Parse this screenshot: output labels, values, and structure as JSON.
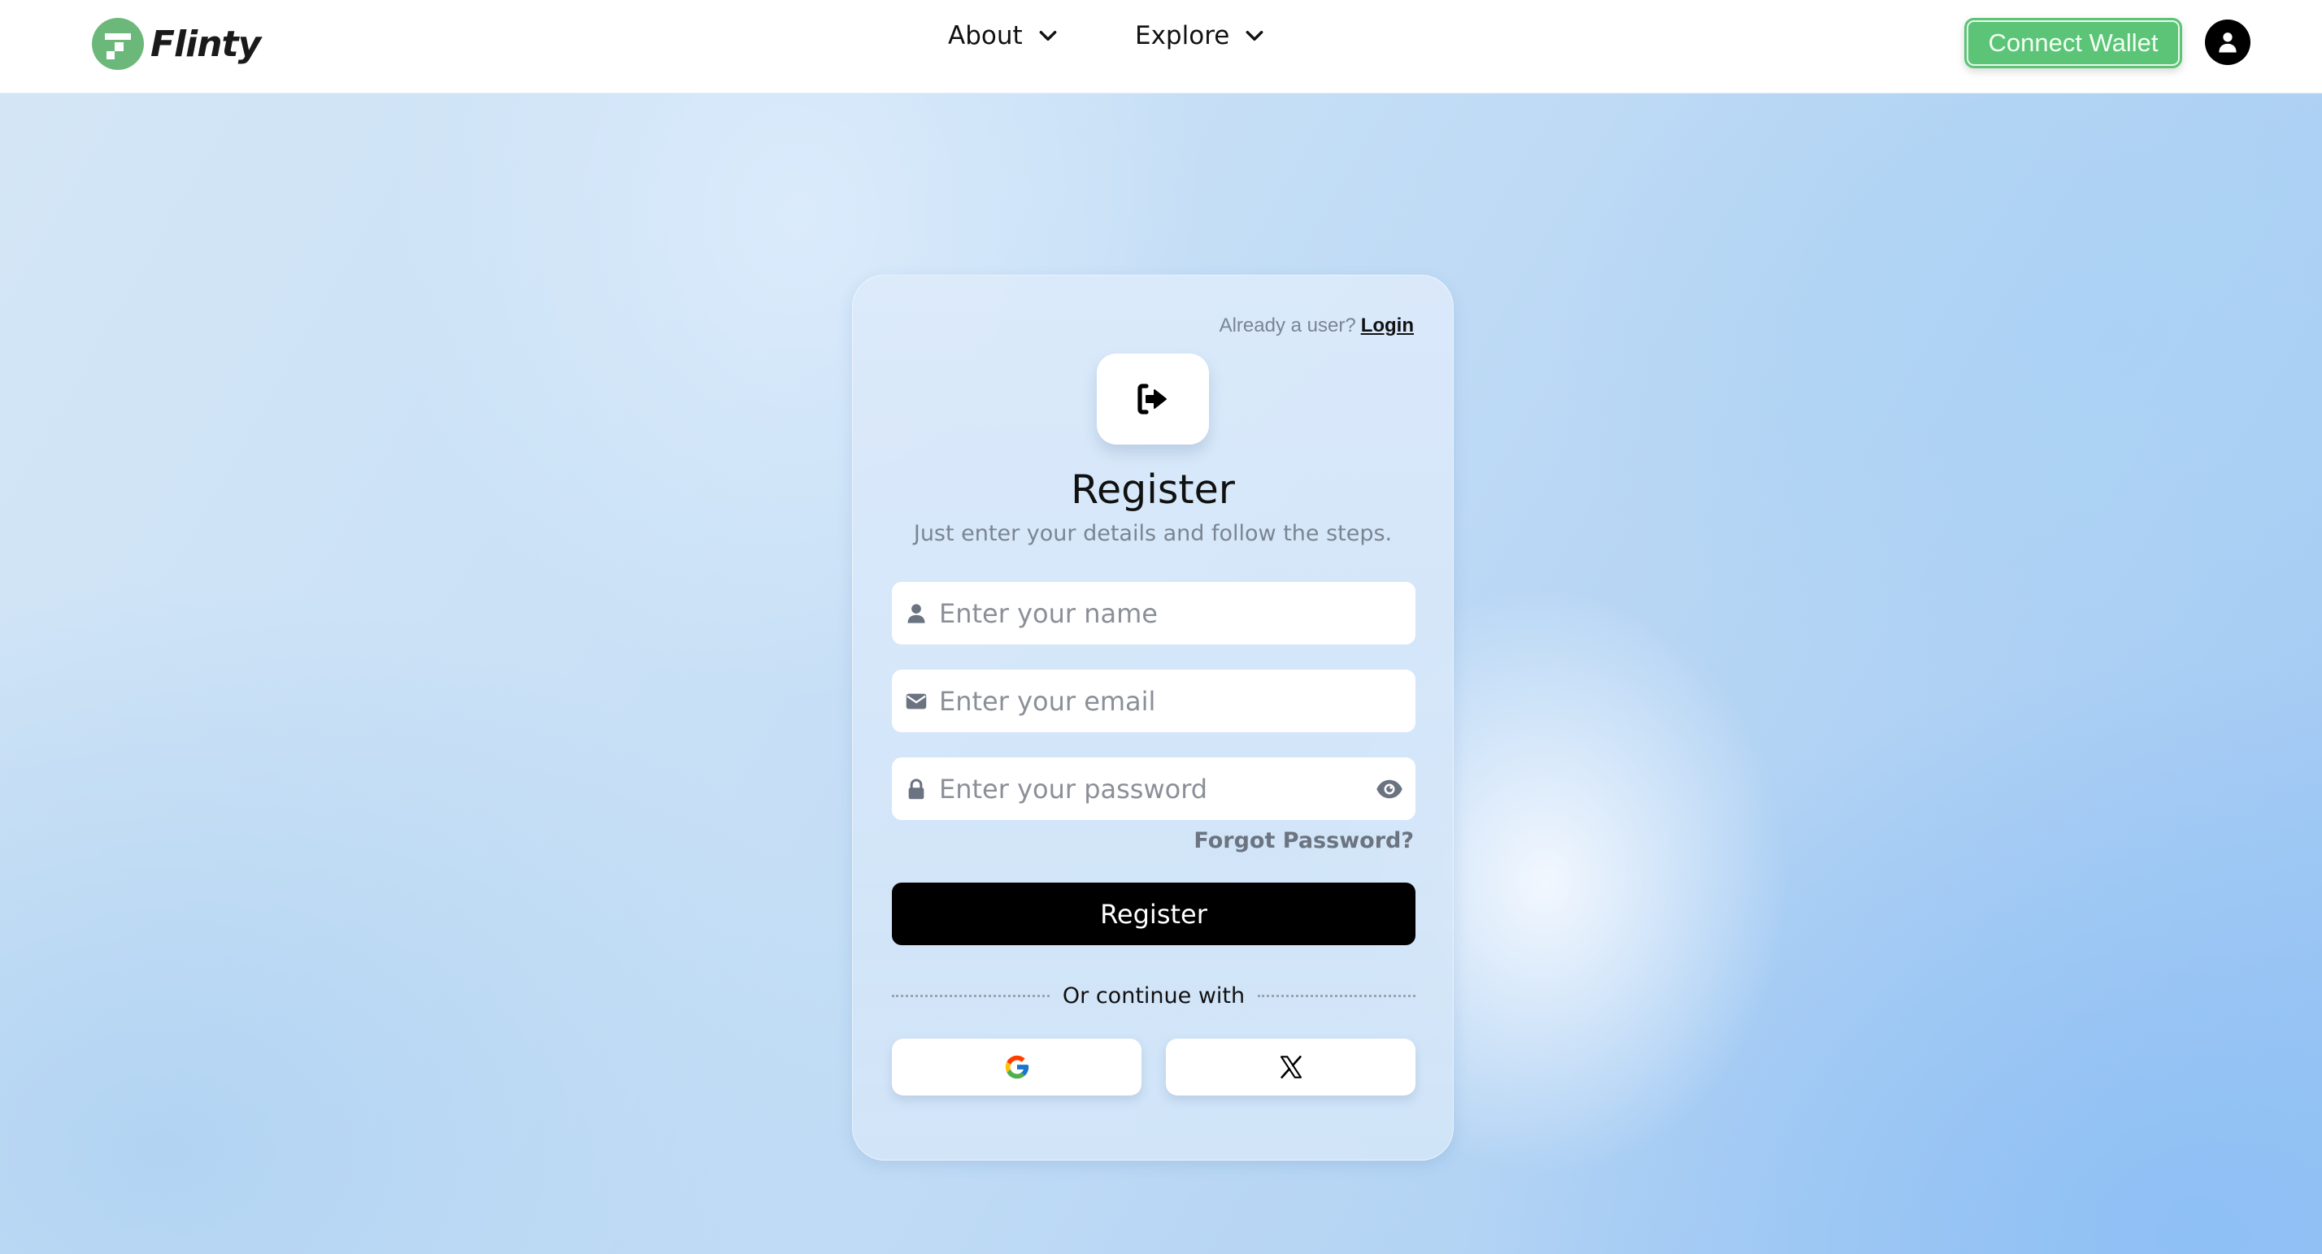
{
  "navbar": {
    "brand": "Flinty",
    "menu": [
      {
        "label": "About",
        "icon": "chevron-down-icon"
      },
      {
        "label": "Explore",
        "icon": "chevron-down-icon"
      }
    ],
    "connect_wallet_label": "Connect Wallet",
    "profile_icon": "user-circle-icon"
  },
  "colors": {
    "brand_green": "#6cb87b",
    "connect_green": "#5cc476",
    "primary_button": "#000000"
  },
  "card": {
    "already_user_text": "Already a user?",
    "login_link": "Login",
    "header_icon": "sign-in-icon",
    "title": "Register",
    "subtitle": "Just enter your details and follow the steps.",
    "fields": {
      "name": {
        "placeholder": "Enter your name",
        "value": "",
        "icon": "user-icon"
      },
      "email": {
        "placeholder": "Enter your email",
        "value": "",
        "icon": "envelope-icon"
      },
      "password": {
        "placeholder": "Enter your password",
        "value": "",
        "icon": "lock-icon",
        "toggle_icon": "eye-icon"
      }
    },
    "forgot_password": "Forgot Password?",
    "register_button": "Register",
    "divider_text": "Or continue with",
    "social": [
      {
        "name": "Google",
        "icon": "google-icon"
      },
      {
        "name": "X",
        "icon": "x-icon"
      }
    ]
  }
}
